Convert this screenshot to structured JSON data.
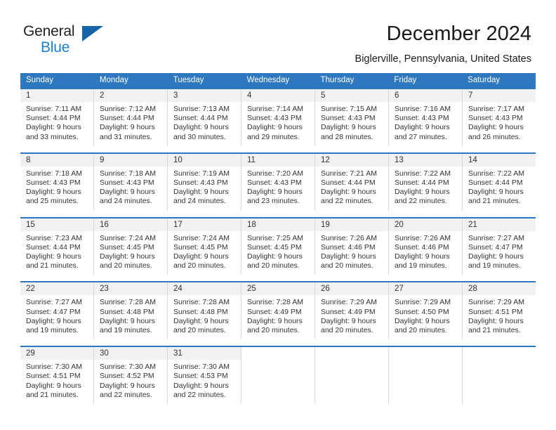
{
  "brand": {
    "line1": "General",
    "line2": "Blue",
    "triangle_color": "#1565a8",
    "blue_text_color": "#1d7fd0"
  },
  "header": {
    "title": "December 2024",
    "location": "Biglerville, Pennsylvania, United States"
  },
  "theme": {
    "header_blue": "#2e78c0",
    "daynum_bg": "#f1f1f1",
    "cell_border": "#d9d9d9"
  },
  "weekdays": [
    "Sunday",
    "Monday",
    "Tuesday",
    "Wednesday",
    "Thursday",
    "Friday",
    "Saturday"
  ],
  "weeks": [
    [
      {
        "day": "1",
        "sunrise": "Sunrise: 7:11 AM",
        "sunset": "Sunset: 4:44 PM",
        "daylight1": "Daylight: 9 hours",
        "daylight2": "and 33 minutes."
      },
      {
        "day": "2",
        "sunrise": "Sunrise: 7:12 AM",
        "sunset": "Sunset: 4:44 PM",
        "daylight1": "Daylight: 9 hours",
        "daylight2": "and 31 minutes."
      },
      {
        "day": "3",
        "sunrise": "Sunrise: 7:13 AM",
        "sunset": "Sunset: 4:44 PM",
        "daylight1": "Daylight: 9 hours",
        "daylight2": "and 30 minutes."
      },
      {
        "day": "4",
        "sunrise": "Sunrise: 7:14 AM",
        "sunset": "Sunset: 4:43 PM",
        "daylight1": "Daylight: 9 hours",
        "daylight2": "and 29 minutes."
      },
      {
        "day": "5",
        "sunrise": "Sunrise: 7:15 AM",
        "sunset": "Sunset: 4:43 PM",
        "daylight1": "Daylight: 9 hours",
        "daylight2": "and 28 minutes."
      },
      {
        "day": "6",
        "sunrise": "Sunrise: 7:16 AM",
        "sunset": "Sunset: 4:43 PM",
        "daylight1": "Daylight: 9 hours",
        "daylight2": "and 27 minutes."
      },
      {
        "day": "7",
        "sunrise": "Sunrise: 7:17 AM",
        "sunset": "Sunset: 4:43 PM",
        "daylight1": "Daylight: 9 hours",
        "daylight2": "and 26 minutes."
      }
    ],
    [
      {
        "day": "8",
        "sunrise": "Sunrise: 7:18 AM",
        "sunset": "Sunset: 4:43 PM",
        "daylight1": "Daylight: 9 hours",
        "daylight2": "and 25 minutes."
      },
      {
        "day": "9",
        "sunrise": "Sunrise: 7:18 AM",
        "sunset": "Sunset: 4:43 PM",
        "daylight1": "Daylight: 9 hours",
        "daylight2": "and 24 minutes."
      },
      {
        "day": "10",
        "sunrise": "Sunrise: 7:19 AM",
        "sunset": "Sunset: 4:43 PM",
        "daylight1": "Daylight: 9 hours",
        "daylight2": "and 24 minutes."
      },
      {
        "day": "11",
        "sunrise": "Sunrise: 7:20 AM",
        "sunset": "Sunset: 4:43 PM",
        "daylight1": "Daylight: 9 hours",
        "daylight2": "and 23 minutes."
      },
      {
        "day": "12",
        "sunrise": "Sunrise: 7:21 AM",
        "sunset": "Sunset: 4:44 PM",
        "daylight1": "Daylight: 9 hours",
        "daylight2": "and 22 minutes."
      },
      {
        "day": "13",
        "sunrise": "Sunrise: 7:22 AM",
        "sunset": "Sunset: 4:44 PM",
        "daylight1": "Daylight: 9 hours",
        "daylight2": "and 22 minutes."
      },
      {
        "day": "14",
        "sunrise": "Sunrise: 7:22 AM",
        "sunset": "Sunset: 4:44 PM",
        "daylight1": "Daylight: 9 hours",
        "daylight2": "and 21 minutes."
      }
    ],
    [
      {
        "day": "15",
        "sunrise": "Sunrise: 7:23 AM",
        "sunset": "Sunset: 4:44 PM",
        "daylight1": "Daylight: 9 hours",
        "daylight2": "and 21 minutes."
      },
      {
        "day": "16",
        "sunrise": "Sunrise: 7:24 AM",
        "sunset": "Sunset: 4:45 PM",
        "daylight1": "Daylight: 9 hours",
        "daylight2": "and 20 minutes."
      },
      {
        "day": "17",
        "sunrise": "Sunrise: 7:24 AM",
        "sunset": "Sunset: 4:45 PM",
        "daylight1": "Daylight: 9 hours",
        "daylight2": "and 20 minutes."
      },
      {
        "day": "18",
        "sunrise": "Sunrise: 7:25 AM",
        "sunset": "Sunset: 4:45 PM",
        "daylight1": "Daylight: 9 hours",
        "daylight2": "and 20 minutes."
      },
      {
        "day": "19",
        "sunrise": "Sunrise: 7:26 AM",
        "sunset": "Sunset: 4:46 PM",
        "daylight1": "Daylight: 9 hours",
        "daylight2": "and 20 minutes."
      },
      {
        "day": "20",
        "sunrise": "Sunrise: 7:26 AM",
        "sunset": "Sunset: 4:46 PM",
        "daylight1": "Daylight: 9 hours",
        "daylight2": "and 19 minutes."
      },
      {
        "day": "21",
        "sunrise": "Sunrise: 7:27 AM",
        "sunset": "Sunset: 4:47 PM",
        "daylight1": "Daylight: 9 hours",
        "daylight2": "and 19 minutes."
      }
    ],
    [
      {
        "day": "22",
        "sunrise": "Sunrise: 7:27 AM",
        "sunset": "Sunset: 4:47 PM",
        "daylight1": "Daylight: 9 hours",
        "daylight2": "and 19 minutes."
      },
      {
        "day": "23",
        "sunrise": "Sunrise: 7:28 AM",
        "sunset": "Sunset: 4:48 PM",
        "daylight1": "Daylight: 9 hours",
        "daylight2": "and 19 minutes."
      },
      {
        "day": "24",
        "sunrise": "Sunrise: 7:28 AM",
        "sunset": "Sunset: 4:48 PM",
        "daylight1": "Daylight: 9 hours",
        "daylight2": "and 20 minutes."
      },
      {
        "day": "25",
        "sunrise": "Sunrise: 7:28 AM",
        "sunset": "Sunset: 4:49 PM",
        "daylight1": "Daylight: 9 hours",
        "daylight2": "and 20 minutes."
      },
      {
        "day": "26",
        "sunrise": "Sunrise: 7:29 AM",
        "sunset": "Sunset: 4:49 PM",
        "daylight1": "Daylight: 9 hours",
        "daylight2": "and 20 minutes."
      },
      {
        "day": "27",
        "sunrise": "Sunrise: 7:29 AM",
        "sunset": "Sunset: 4:50 PM",
        "daylight1": "Daylight: 9 hours",
        "daylight2": "and 20 minutes."
      },
      {
        "day": "28",
        "sunrise": "Sunrise: 7:29 AM",
        "sunset": "Sunset: 4:51 PM",
        "daylight1": "Daylight: 9 hours",
        "daylight2": "and 21 minutes."
      }
    ],
    [
      {
        "day": "29",
        "sunrise": "Sunrise: 7:30 AM",
        "sunset": "Sunset: 4:51 PM",
        "daylight1": "Daylight: 9 hours",
        "daylight2": "and 21 minutes."
      },
      {
        "day": "30",
        "sunrise": "Sunrise: 7:30 AM",
        "sunset": "Sunset: 4:52 PM",
        "daylight1": "Daylight: 9 hours",
        "daylight2": "and 22 minutes."
      },
      {
        "day": "31",
        "sunrise": "Sunrise: 7:30 AM",
        "sunset": "Sunset: 4:53 PM",
        "daylight1": "Daylight: 9 hours",
        "daylight2": "and 22 minutes."
      },
      {
        "day": "",
        "sunrise": "",
        "sunset": "",
        "daylight1": "",
        "daylight2": ""
      },
      {
        "day": "",
        "sunrise": "",
        "sunset": "",
        "daylight1": "",
        "daylight2": ""
      },
      {
        "day": "",
        "sunrise": "",
        "sunset": "",
        "daylight1": "",
        "daylight2": ""
      },
      {
        "day": "",
        "sunrise": "",
        "sunset": "",
        "daylight1": "",
        "daylight2": ""
      }
    ]
  ]
}
